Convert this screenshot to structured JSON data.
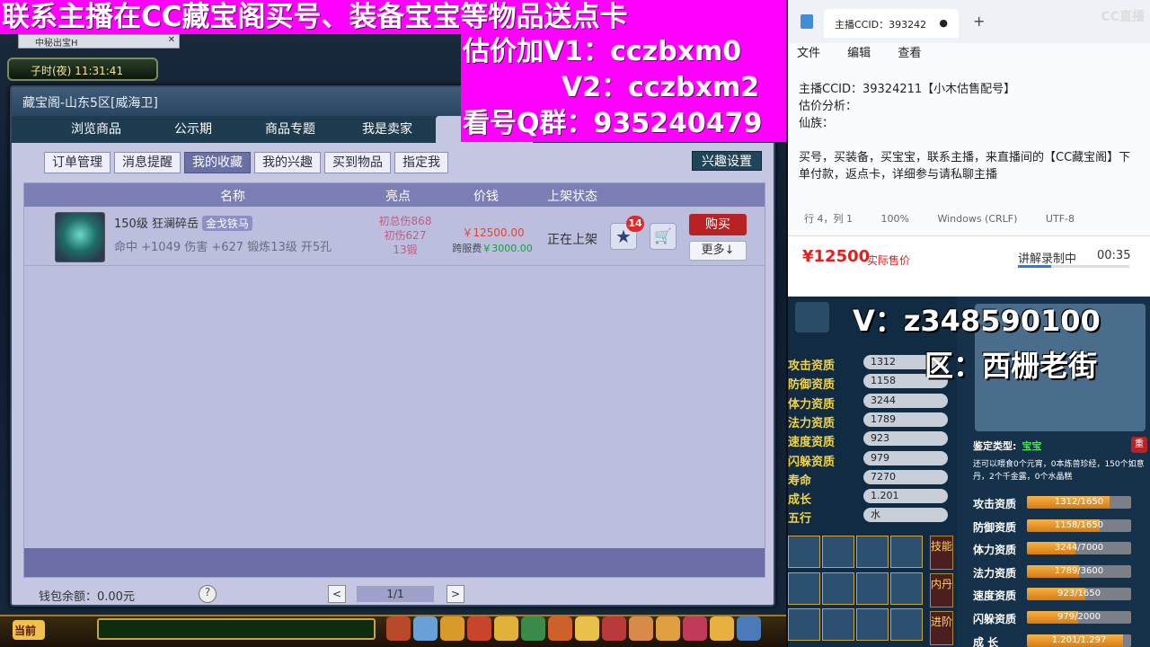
{
  "game": {
    "tab_title": "中秘出宝H",
    "clock": "子时(夜)  11:31:41",
    "chat_channel": "当前"
  },
  "market": {
    "title": "藏宝阁-山东5区[威海卫]",
    "tabs": [
      "浏览商品",
      "公示期",
      "商品专题",
      "我是卖家",
      "我"
    ],
    "subtabs": [
      "订单管理",
      "消息提醒",
      "我的收藏",
      "我的兴趣",
      "买到物品",
      "指定我"
    ],
    "interest_button": "兴趣设置",
    "columns": [
      "名称",
      "亮点",
      "价钱",
      "上架状态"
    ],
    "item": {
      "name": "150级  狂澜碎岳",
      "tag": "金戈铁马",
      "stats": "命中 +1049  伤害 +627  锻炼13级  开5孔",
      "highlights": [
        "初总伤868",
        "初伤627",
        "13锻"
      ],
      "price": "￥12500.00",
      "fee_label": "跨服费",
      "fee": "￥3000.00",
      "status": "正在上架",
      "fav_count": "14",
      "buy": "购买",
      "more": "更多↓"
    },
    "wallet": "钱包余额：0.00元",
    "help": "?",
    "page": "1/1",
    "prev": "<",
    "next": ">"
  },
  "banner": {
    "top": "联系主播在CC藏宝阁买号、装备宝宝等物品送点卡",
    "line1": "估价加V1：cczbxm0",
    "line2": "V2：cczbxm2",
    "line3": "看号Q群：935240479"
  },
  "notepad": {
    "tab_title": "主播CCID：393242",
    "close": "●",
    "plus": "+",
    "logo": "CC直播",
    "menu": [
      "文件",
      "编辑",
      "查看"
    ],
    "lines": [
      "主播CCID：39324211【小木估售配号】",
      "估价分析：",
      "仙族：",
      "",
      "买号，买装备，买宝宝，联系主播，来直播间的【CC藏宝阁】下单付款，返点卡，详细参与请私聊主播"
    ],
    "status": [
      "行 4，列 1",
      "100%",
      "Windows (CRLF)",
      "UTF-8"
    ]
  },
  "price_strip": {
    "price": "¥12500",
    "label": "实际售价",
    "recording": "讲解录制中",
    "time": "00:35"
  },
  "pet_panel": {
    "overlay_v": "V：z348590100",
    "overlay_area": "区：西栅老街",
    "stats": [
      {
        "label": "攻击资质",
        "value": "1312"
      },
      {
        "label": "防御资质",
        "value": "1158"
      },
      {
        "label": "体力资质",
        "value": "3244"
      },
      {
        "label": "法力资质",
        "value": "1789"
      },
      {
        "label": "速度资质",
        "value": "923"
      },
      {
        "label": "闪躲资质",
        "value": "979"
      },
      {
        "label": "寿命",
        "value": "7270"
      },
      {
        "label": "成长",
        "value": "1.201"
      },
      {
        "label": "五行",
        "value": "水"
      }
    ],
    "side_buttons": [
      "技能",
      "内丹",
      "进阶"
    ],
    "type_label": "鉴定类型:",
    "type_value": "宝宝",
    "type_btn": "重",
    "desc": "还可以喂食0个元宵，0本炼兽珍经，150个如意丹，2个千金露，0个水晶糕",
    "bars": [
      {
        "label": "攻击资质",
        "text": "1312/1650",
        "ratio": 0.795
      },
      {
        "label": "防御资质",
        "text": "1158/1650",
        "ratio": 0.702
      },
      {
        "label": "体力资质",
        "text": "3244/7000",
        "ratio": 0.463
      },
      {
        "label": "法力资质",
        "text": "1789/3600",
        "ratio": 0.497
      },
      {
        "label": "速度资质",
        "text": "923/1650",
        "ratio": 0.559
      },
      {
        "label": "闪躲资质",
        "text": "979/2000",
        "ratio": 0.49
      },
      {
        "label": "成  长",
        "text": "1.201/1.297",
        "ratio": 0.926
      }
    ]
  }
}
